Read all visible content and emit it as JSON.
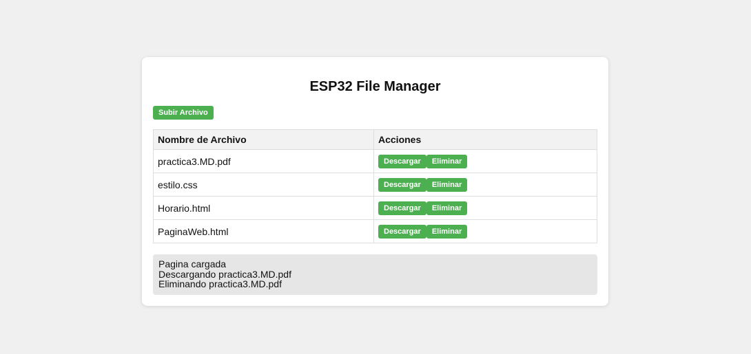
{
  "app": {
    "title": "ESP32 File Manager"
  },
  "toolbar": {
    "upload_label": "Subir Archivo"
  },
  "table": {
    "headers": [
      "Nombre de Archivo",
      "Acciones"
    ],
    "rows": [
      {
        "filename": "practica3.MD.pdf",
        "download_label": "Descargar",
        "delete_label": "Eliminar"
      },
      {
        "filename": "estilo.css",
        "download_label": "Descargar",
        "delete_label": "Eliminar"
      },
      {
        "filename": "Horario.html",
        "download_label": "Descargar",
        "delete_label": "Eliminar"
      },
      {
        "filename": "PaginaWeb.html",
        "download_label": "Descargar",
        "delete_label": "Eliminar"
      }
    ]
  },
  "log": {
    "lines": [
      "Pagina cargada",
      "Descargando practica3.MD.pdf",
      "Eliminando practica3.MD.pdf"
    ]
  },
  "colors": {
    "accent": "#4caf50",
    "background": "#f0f0f0",
    "card": "#ffffff",
    "log_background": "#e6e6e6"
  }
}
